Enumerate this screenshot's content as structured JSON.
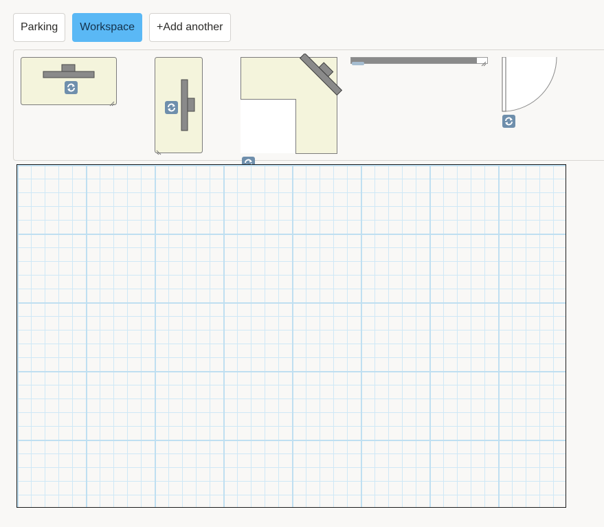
{
  "tabs": [
    {
      "label": "Parking",
      "active": false
    },
    {
      "label": "Workspace",
      "active": true
    },
    {
      "label": "+Add another",
      "active": false
    }
  ],
  "palette": {
    "items": [
      {
        "name": "desk-horizontal",
        "icon": "desk-icon"
      },
      {
        "name": "desk-vertical",
        "icon": "desk-icon"
      },
      {
        "name": "corner-desk",
        "icon": "corner-desk-icon"
      },
      {
        "name": "wall-segment",
        "icon": "wall-icon"
      },
      {
        "name": "door",
        "icon": "door-icon"
      }
    ],
    "rotate_icon": "rotate-icon",
    "resize_icon": "resize-handle-icon"
  },
  "canvas": {
    "grid": true
  },
  "colors": {
    "accent": "#5ab8f5",
    "desk_fill": "#f4f4dc",
    "furniture_gray": "#8a8a8a",
    "grid_line": "#cfe8f6",
    "rotate_icon": "#6f8fac"
  }
}
